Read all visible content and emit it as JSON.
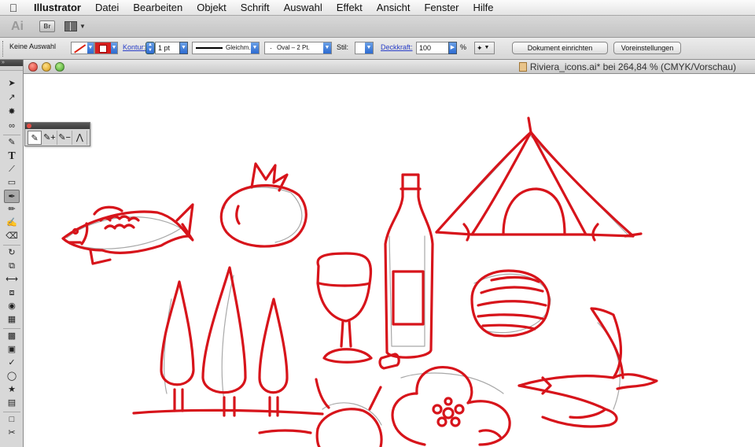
{
  "menubar": {
    "apple_icon": "apple-icon",
    "items": [
      "Illustrator",
      "Datei",
      "Bearbeiten",
      "Objekt",
      "Schrift",
      "Auswahl",
      "Effekt",
      "Ansicht",
      "Fenster",
      "Hilfe"
    ]
  },
  "appbar": {
    "app_logo": "Ai",
    "bridge_label": "Br",
    "arrange_icon": "arrange-documents-icon"
  },
  "controlbar": {
    "selection_status": "Keine Auswahl",
    "stroke_label": "Kontur:",
    "stroke_weight": "1 pt",
    "stroke_profile": "Gleichm.",
    "brush_label": "Oval – 2 Pt.",
    "style_label": "Stil:",
    "opacity_label": "Deckkraft:",
    "opacity_value": "100",
    "opacity_unit": "%",
    "document_setup_button": "Dokument einrichten",
    "preferences_button": "Voreinstellungen",
    "fill_color": "none",
    "stroke_color": "#d61f1f"
  },
  "document": {
    "title": "Riviera_icons.ai* bei 264,84 % (CMYK/Vorschau)"
  },
  "tools": {
    "active_tool": "paintbrush-tool",
    "items": [
      "selection-tool",
      "direct-selection-tool",
      "magic-wand-tool",
      "lasso-tool",
      "pen-tool",
      "type-tool",
      "line-segment-tool",
      "rectangle-tool",
      "paintbrush-tool",
      "pencil-tool",
      "blob-brush-tool",
      "eraser-tool",
      "rotate-tool",
      "scale-tool",
      "width-tool",
      "free-transform-tool",
      "shape-builder-tool",
      "perspective-grid-tool",
      "mesh-tool",
      "gradient-tool",
      "eyedropper-tool",
      "blend-tool",
      "symbol-sprayer-tool",
      "column-graph-tool",
      "artboard-tool",
      "slice-tool"
    ]
  },
  "pen_tearoff": {
    "items": [
      "pen-tool",
      "add-anchor-point-tool",
      "delete-anchor-point-tool",
      "convert-anchor-point-tool"
    ]
  },
  "artwork": {
    "ink_color": "#d7141b",
    "sketch_color": "#8c8c8c",
    "icons": [
      "fish",
      "tomato",
      "wine-bottle",
      "tent",
      "wine-glass",
      "cork",
      "shell",
      "cypress-trees",
      "swallow",
      "flower",
      "orange"
    ]
  }
}
